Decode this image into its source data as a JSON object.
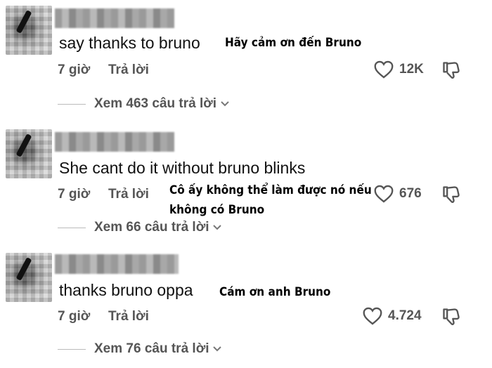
{
  "comments": [
    {
      "text": "say thanks to bruno",
      "translation": "Hãy cảm ơn đến Bruno",
      "time": "7 giờ",
      "reply_label": "Trả lời",
      "likes": "12K",
      "view_replies": "Xem 463 câu trả lời"
    },
    {
      "text": "She cant do it without bruno blinks",
      "translation_line1": "Cô ấy không thể làm được nó nếu",
      "translation_line2": "không có Bruno",
      "time": "7 giờ",
      "reply_label": "Trả lời",
      "likes": "676",
      "view_replies": "Xem 66 câu trả lời"
    },
    {
      "text": "thanks bruno oppa",
      "translation": "Cám ơn anh Bruno",
      "time": "7 giờ",
      "reply_label": "Trả lời",
      "likes": "4.724",
      "view_replies": "Xem 76 câu trả lời"
    }
  ],
  "icons": {
    "like": "heart-outline-icon",
    "dislike": "thumbs-down-icon",
    "expand": "chevron-down-icon"
  },
  "colors": {
    "text": "#111111",
    "meta": "#555555",
    "background": "#ffffff"
  }
}
